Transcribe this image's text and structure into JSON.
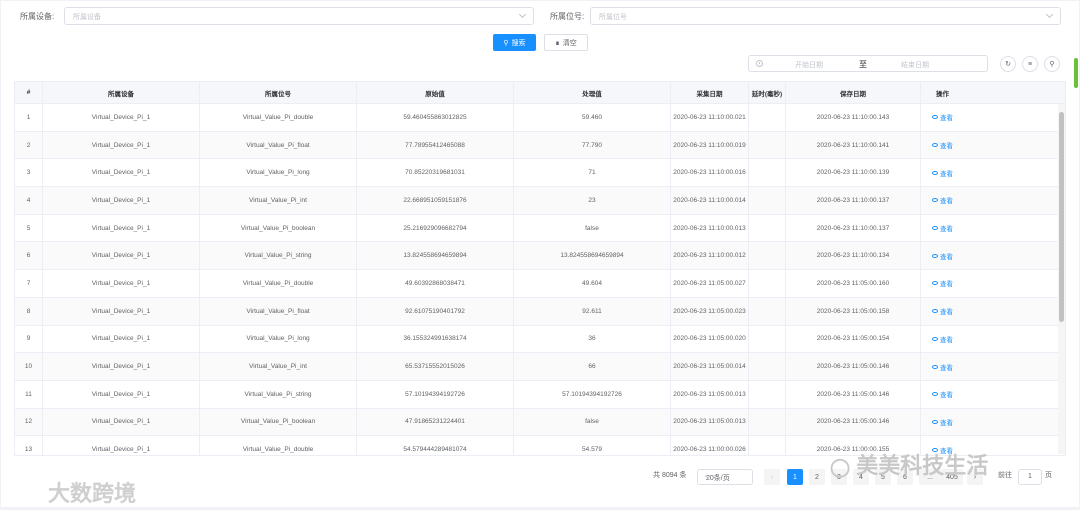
{
  "filters": {
    "device_label": "所属设备:",
    "device_placeholder": "所属设备",
    "position_label": "所属位号:",
    "position_placeholder": "所属位号"
  },
  "actions": {
    "search": "搜索",
    "reset": "清空"
  },
  "date_range": {
    "start_placeholder": "开始日期",
    "separator": "至",
    "end_placeholder": "结束日期"
  },
  "table": {
    "headers": [
      "#",
      "所属设备",
      "所属位号",
      "原始值",
      "处理值",
      "采集日期",
      "延时(毫秒)",
      "保存日期",
      "操作"
    ],
    "action_label": "查看",
    "rows": [
      [
        "1",
        "Virtual_Device_Pi_1",
        "Virtual_Value_Pi_double",
        "59.460455863012825",
        "59.460",
        "2020-06-23 11:10:00.021",
        "",
        "2020-06-23 11:10:00.143"
      ],
      [
        "2",
        "Virtual_Device_Pi_1",
        "Virtual_Value_Pi_float",
        "77.78955412465088",
        "77.790",
        "2020-06-23 11:10:00.019",
        "",
        "2020-06-23 11:10:00.141"
      ],
      [
        "3",
        "Virtual_Device_Pi_1",
        "Virtual_Value_Pi_long",
        "70.85220319681031",
        "71",
        "2020-06-23 11:10:00.016",
        "",
        "2020-06-23 11:10:00.139"
      ],
      [
        "4",
        "Virtual_Device_Pi_1",
        "Virtual_Value_Pi_int",
        "22.668951059151876",
        "23",
        "2020-06-23 11:10:00.014",
        "",
        "2020-06-23 11:10:00.137"
      ],
      [
        "5",
        "Virtual_Device_Pi_1",
        "Virtual_Value_Pi_boolean",
        "25.216929096682794",
        "false",
        "2020-06-23 11:10:00.013",
        "",
        "2020-06-23 11:10:00.137"
      ],
      [
        "6",
        "Virtual_Device_Pi_1",
        "Virtual_Value_Pi_string",
        "13.824558694659894",
        "13.824558694659894",
        "2020-06-23 11:10:00.012",
        "",
        "2020-06-23 11:10:00.134"
      ],
      [
        "7",
        "Virtual_Device_Pi_1",
        "Virtual_Value_Pi_double",
        "49.60392868038471",
        "49.604",
        "2020-06-23 11:05:00.027",
        "",
        "2020-06-23 11:05:00.160"
      ],
      [
        "8",
        "Virtual_Device_Pi_1",
        "Virtual_Value_Pi_float",
        "92.61075190401792",
        "92.611",
        "2020-06-23 11:05:00.023",
        "",
        "2020-06-23 11:05:00.158"
      ],
      [
        "9",
        "Virtual_Device_Pi_1",
        "Virtual_Value_Pi_long",
        "36.155324991638174",
        "36",
        "2020-06-23 11:05:00.020",
        "",
        "2020-06-23 11:05:00.154"
      ],
      [
        "10",
        "Virtual_Device_Pi_1",
        "Virtual_Value_Pi_int",
        "65.53715552015026",
        "66",
        "2020-06-23 11:05:00.014",
        "",
        "2020-06-23 11:05:00.146"
      ],
      [
        "11",
        "Virtual_Device_Pi_1",
        "Virtual_Value_Pi_string",
        "57.10194394192726",
        "57.10194394192726",
        "2020-06-23 11:05:00.013",
        "",
        "2020-06-23 11:05:00.146"
      ],
      [
        "12",
        "Virtual_Device_Pi_1",
        "Virtual_Value_Pi_boolean",
        "47.91865231224401",
        "false",
        "2020-06-23 11:05:00.013",
        "",
        "2020-06-23 11:05:00.146"
      ],
      [
        "13",
        "Virtual_Device_Pi_1",
        "Virtual_Value_Pi_double",
        "54.579444289481074",
        "54.579",
        "2020-06-23 11:00:00.026",
        "",
        "2020-06-23 11:00:00.155"
      ]
    ]
  },
  "pagination": {
    "total": "共 8094 条",
    "page_size": "20条/页",
    "pages": [
      "1",
      "2",
      "3",
      "4",
      "5",
      "6",
      "...",
      "405"
    ],
    "current_page": "1",
    "goto_label": "前往",
    "goto_value": "1",
    "goto_suffix": "页"
  },
  "watermarks": {
    "left": "大数跨境",
    "right": "美美科技生活"
  },
  "colors": {
    "primary": "#1890ff",
    "border": "#dcdfe6",
    "header_bg": "#f5f7fa"
  }
}
